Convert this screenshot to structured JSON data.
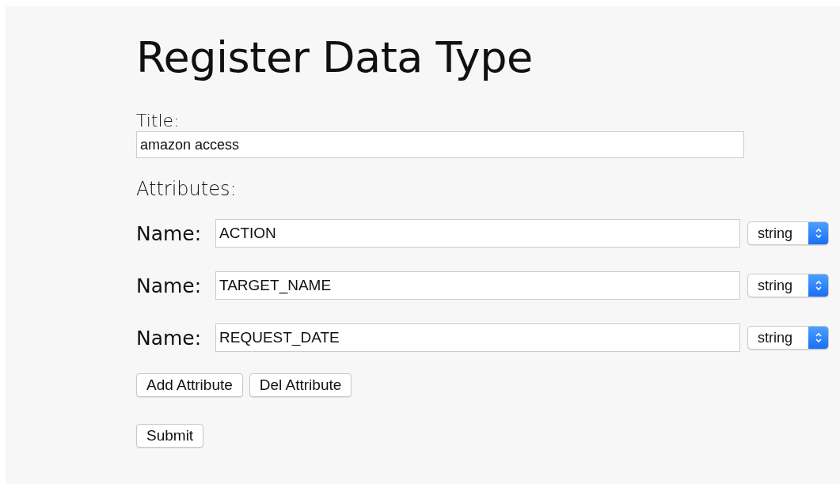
{
  "heading": "Register Data Type",
  "title_field": {
    "label": "Title:",
    "value": "amazon access"
  },
  "attributes_label": "Attributes:",
  "attributes": [
    {
      "label": "Name:",
      "value": "ACTION",
      "type": "string"
    },
    {
      "label": "Name:",
      "value": "TARGET_NAME",
      "type": "string"
    },
    {
      "label": "Name:",
      "value": "REQUEST_DATE",
      "type": "string"
    }
  ],
  "buttons": [
    "Add Attribute",
    "Del Attribute"
  ],
  "submit": "Submit"
}
